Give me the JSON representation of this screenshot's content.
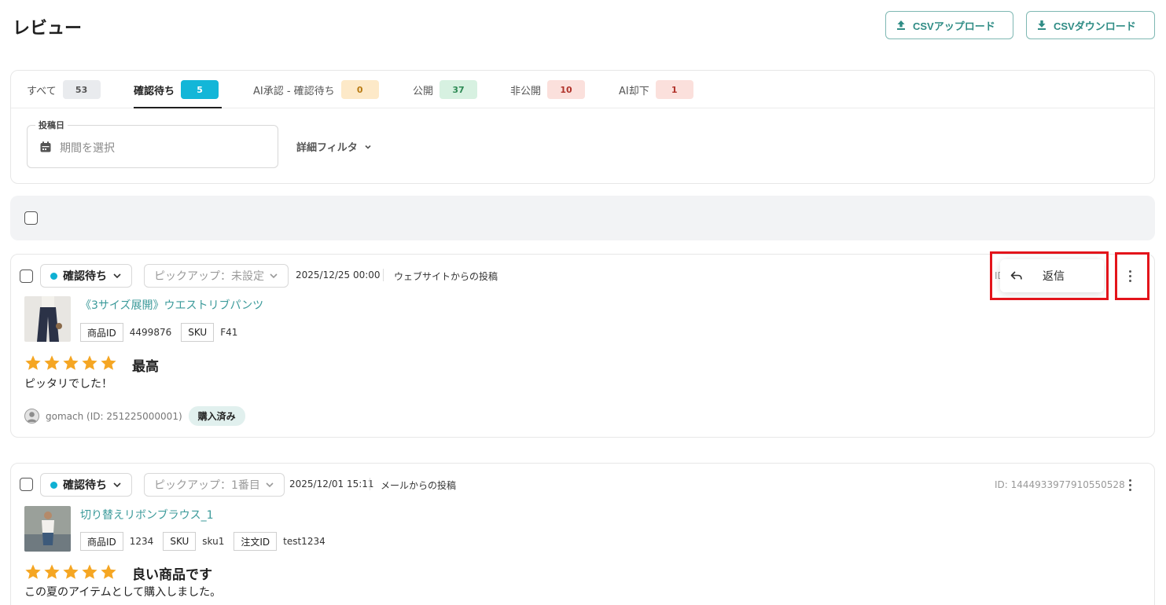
{
  "page": {
    "title": "レビュー"
  },
  "toolbar": {
    "upload_label": "CSVアップロード",
    "download_label": "CSVダウンロード"
  },
  "tabs": [
    {
      "label": "すべて",
      "count": "53",
      "count_bg": "#e9ebee",
      "count_color": "#555555",
      "active": false
    },
    {
      "label": "確認待ち",
      "count": "5",
      "count_bg": "#13b6d8",
      "count_color": "#ffffff",
      "active": true
    },
    {
      "label": "AI承認 - 確認待ち",
      "count": "0",
      "count_bg": "#fde9c8",
      "count_color": "#b87a12",
      "active": false
    },
    {
      "label": "公開",
      "count": "37",
      "count_bg": "#d7f1e1",
      "count_color": "#2e8a55",
      "active": false
    },
    {
      "label": "非公開",
      "count": "10",
      "count_bg": "#fbe0dc",
      "count_color": "#b0322a",
      "active": false
    },
    {
      "label": "AI却下",
      "count": "1",
      "count_bg": "#fbe0dc",
      "count_color": "#b0322a",
      "active": false
    }
  ],
  "filters": {
    "date_label": "投稿日",
    "date_placeholder": "期間を選択",
    "detail_label": "詳細フィルタ"
  },
  "reviews": [
    {
      "status": "確認待ち",
      "pickup": "ピックアップ：未設定",
      "date": "2025/12/25 00:00",
      "source": "ウェブサイトからの投稿",
      "id_label": "ID",
      "product_name": "《3サイズ展開》ウエストリブパンツ",
      "tags": [
        {
          "key": "商品ID",
          "value": "4499876"
        },
        {
          "key": "SKU",
          "value": "F41"
        }
      ],
      "rating": 5,
      "title": "最高",
      "body": "ピッタリでした！",
      "reviewer": "gomach (ID: 251225000001)",
      "badge": "購入済み"
    },
    {
      "status": "確認待ち",
      "pickup": "ピックアップ：1番目",
      "date": "2025/12/01 15:11",
      "source": "メールからの投稿",
      "id_label": "ID: 1444933977910550528",
      "product_name": "切り替えリボンブラウス_1",
      "tags": [
        {
          "key": "商品ID",
          "value": "1234"
        },
        {
          "key": "SKU",
          "value": "sku1"
        },
        {
          "key": "注文ID",
          "value": "test1234"
        }
      ],
      "rating": 5,
      "title": "良い商品です",
      "body": "この夏のアイテムとして購入しました。"
    }
  ],
  "reply_menu": {
    "label": "返信"
  },
  "colors": {
    "accent": "#2f8c85",
    "status_dot": "#0fb0d3",
    "star": "#f5a623",
    "highlight": "#e3141b"
  }
}
